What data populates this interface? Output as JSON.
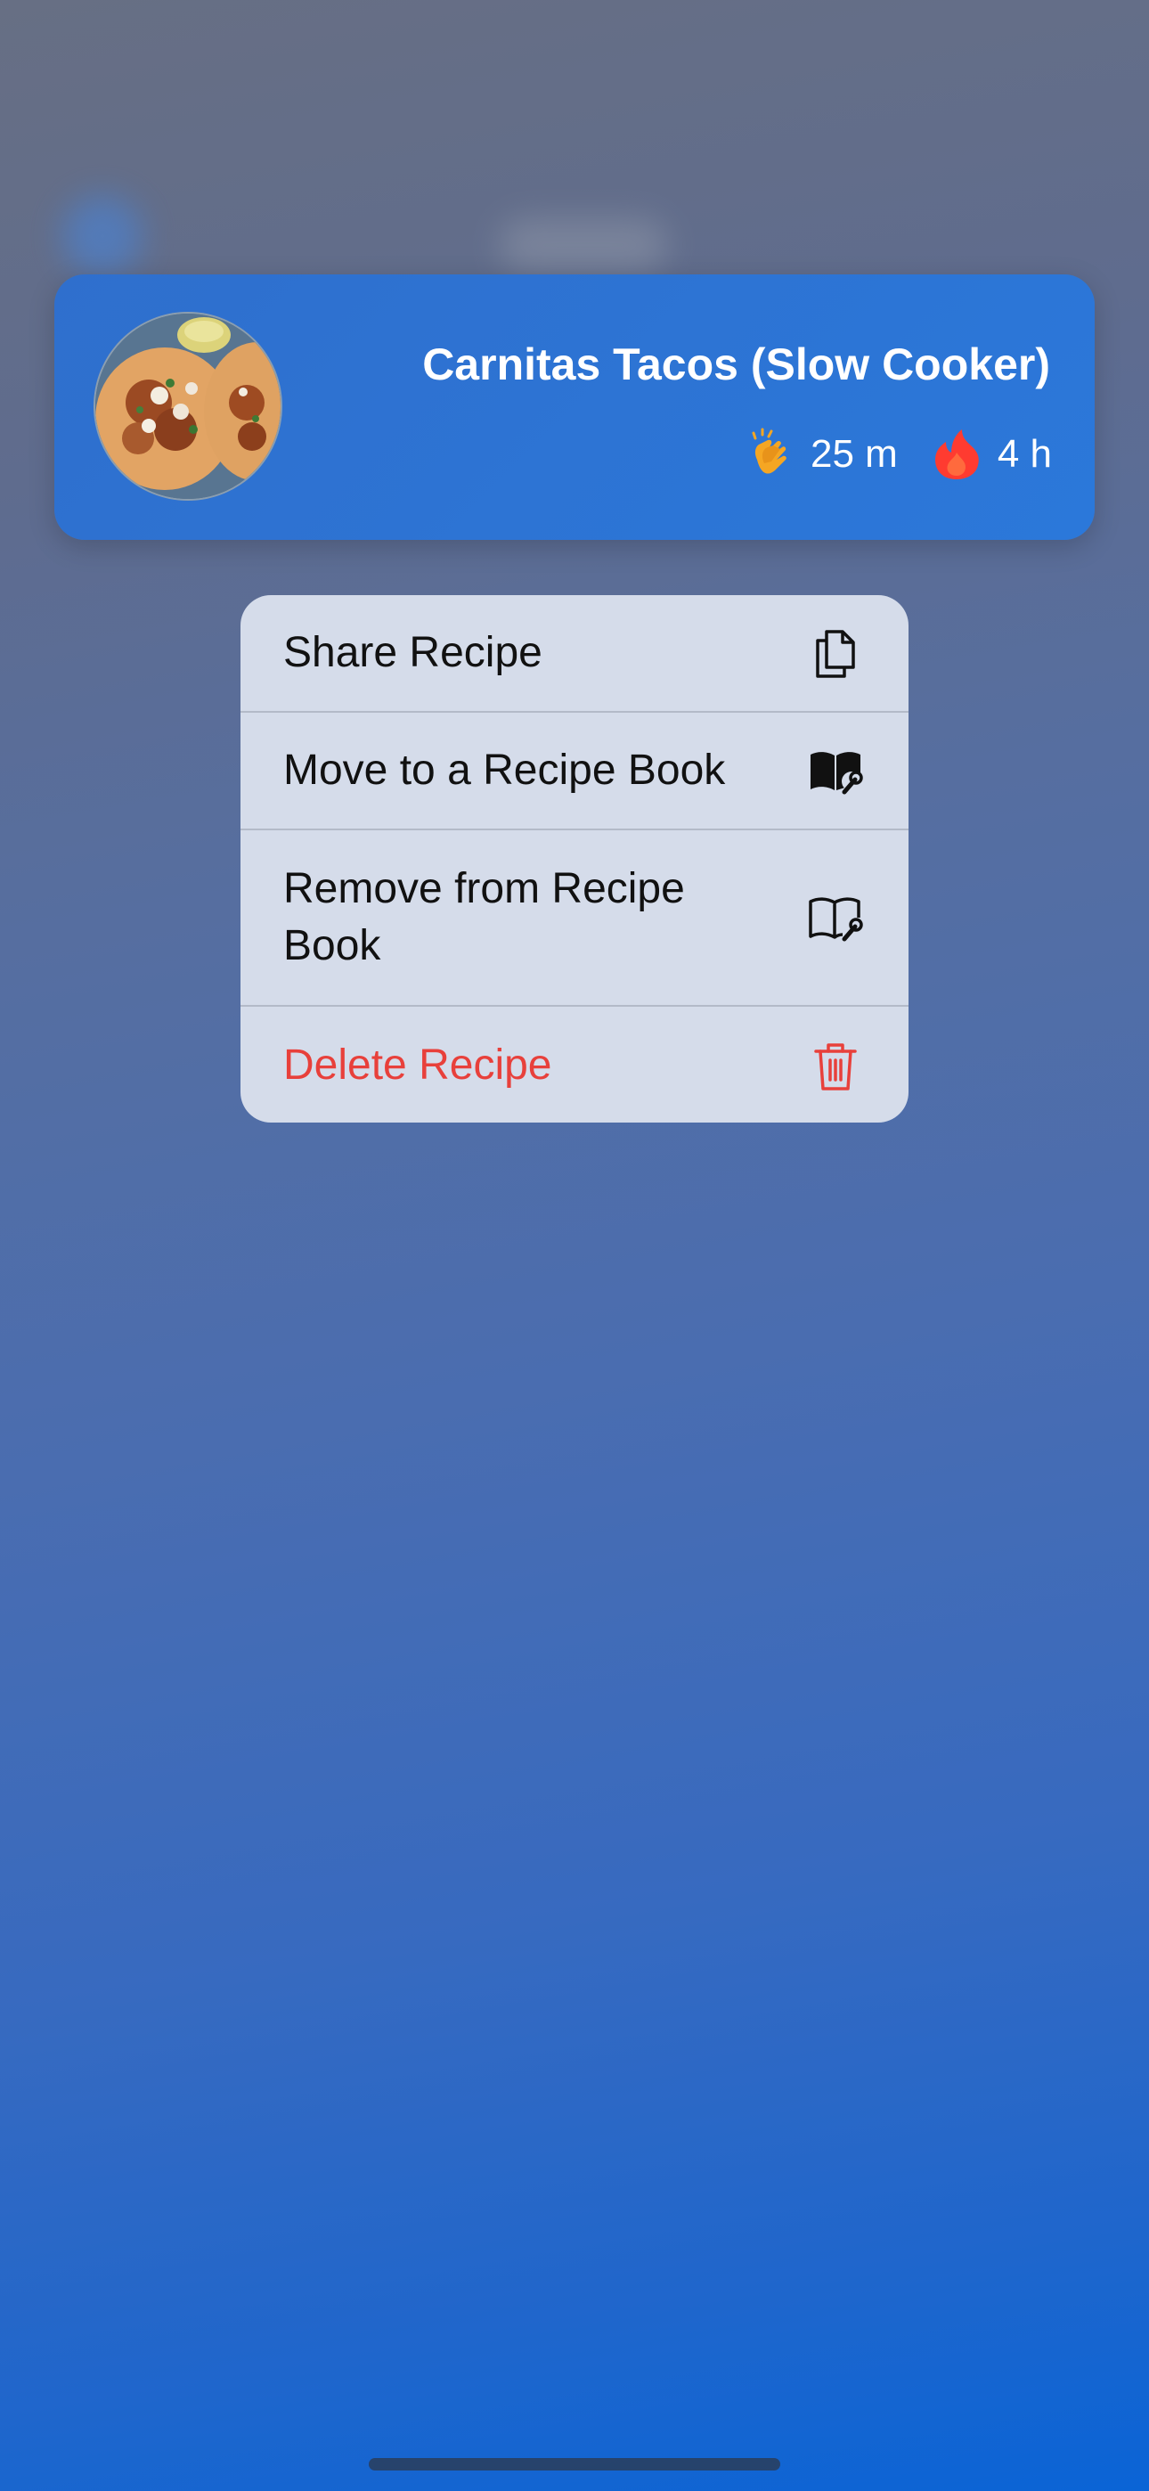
{
  "recipe_card": {
    "title": "Carnitas Tacos (Slow Cooker)",
    "prep_icon": "clapping-hands-icon",
    "prep_time": "25 m",
    "cook_icon": "flame-icon",
    "cook_time": "4 h"
  },
  "context_menu": {
    "items": [
      {
        "label": "Share Recipe",
        "icon": "documents-icon"
      },
      {
        "label": "Move to a Recipe Book",
        "icon": "book-wrench-filled-icon"
      },
      {
        "label": "Remove from Recipe Book",
        "icon": "book-wrench-outline-icon"
      },
      {
        "label": "Delete Recipe",
        "icon": "trash-icon"
      }
    ]
  },
  "colors": {
    "card_blue": "#2b78da",
    "menu_bg": "#d5dcea",
    "destructive": "#e8403b",
    "prep_icon": "#f5a623",
    "cook_icon": "#ff3b30"
  }
}
